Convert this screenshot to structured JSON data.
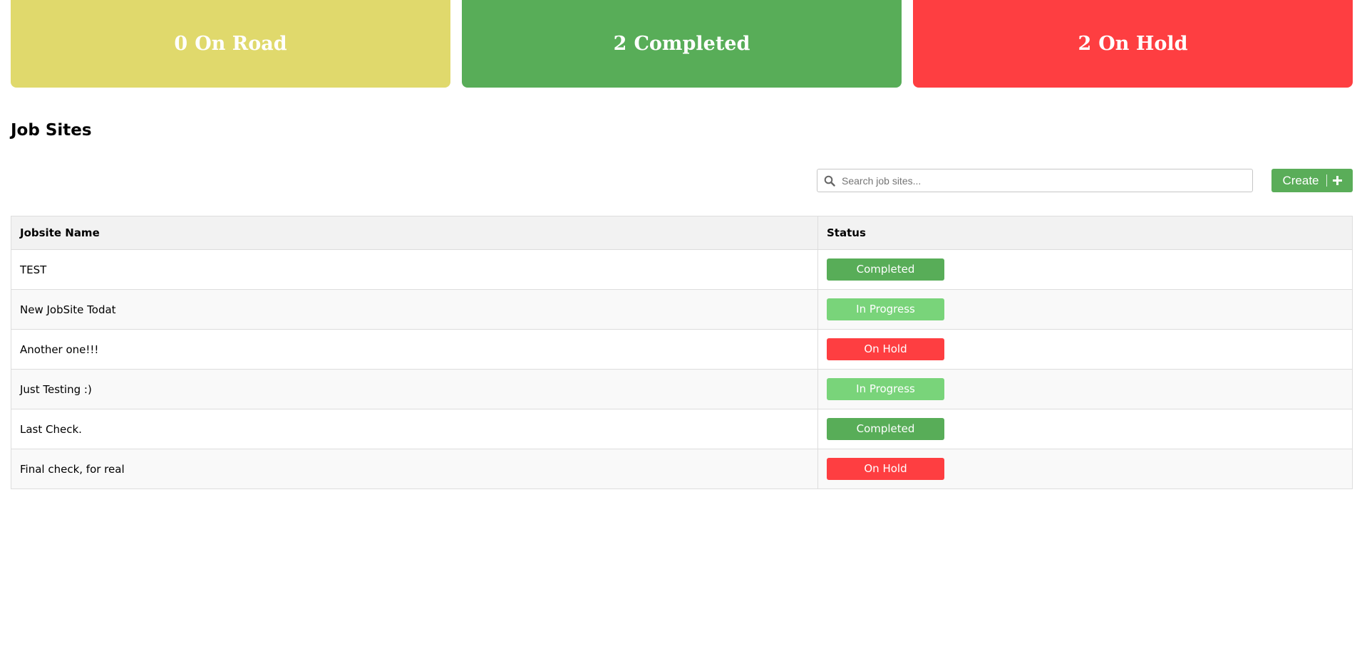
{
  "stats": [
    {
      "count": "0",
      "label": "On Road",
      "color": "#e0d96c"
    },
    {
      "count": "2",
      "label": "Completed",
      "color": "#58ad58"
    },
    {
      "count": "2",
      "label": "On Hold",
      "color": "#fe3e41"
    }
  ],
  "section_title": "Job Sites",
  "search": {
    "placeholder": "Search job sites...",
    "value": "",
    "icon": "search-icon"
  },
  "create_button": {
    "label": "Create",
    "icon": "plus-icon"
  },
  "table": {
    "headers": [
      "Jobsite Name",
      "Status"
    ],
    "rows": [
      {
        "name": "TEST",
        "status": "Completed"
      },
      {
        "name": "New JobSite Todat",
        "status": "In Progress"
      },
      {
        "name": "Another one!!!",
        "status": "On Hold"
      },
      {
        "name": "Just Testing :)",
        "status": "In Progress"
      },
      {
        "name": "Last Check.",
        "status": "Completed"
      },
      {
        "name": "Final check, for real",
        "status": "On Hold"
      }
    ]
  },
  "status_colors": {
    "Completed": "#58ad58",
    "In Progress": "#79d47a",
    "On Hold": "#fe3e41"
  }
}
